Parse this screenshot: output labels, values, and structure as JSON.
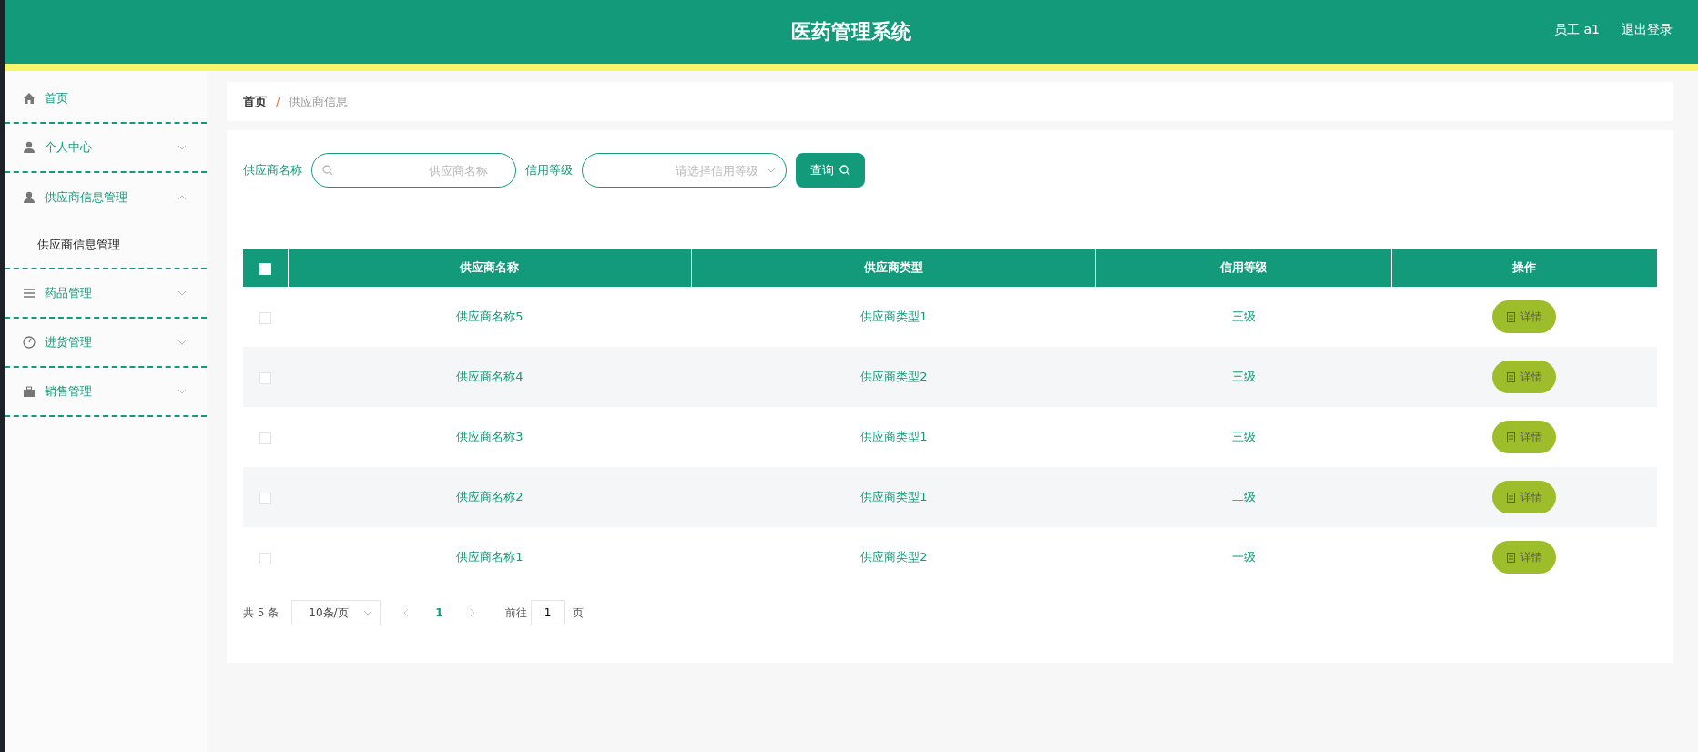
{
  "header": {
    "title": "医药管理系统",
    "user": "员工 a1",
    "logout": "退出登录"
  },
  "sidebar": {
    "items": [
      {
        "label": "首页"
      },
      {
        "label": "个人中心",
        "expanded": false
      },
      {
        "label": "供应商信息管理",
        "expanded": true,
        "children": [
          {
            "label": "供应商信息管理"
          }
        ]
      },
      {
        "label": "药品管理",
        "expanded": false
      },
      {
        "label": "进货管理",
        "expanded": false
      },
      {
        "label": "销售管理",
        "expanded": false
      }
    ]
  },
  "breadcrumb": {
    "separator": "/",
    "items": [
      "首页",
      "供应商信息"
    ]
  },
  "search": {
    "fields": [
      {
        "kind": "input",
        "label": "供应商名称",
        "placeholder": "供应商名称"
      },
      {
        "kind": "select",
        "label": "信用等级",
        "placeholder": "请选择信用等级"
      }
    ],
    "button": "查询"
  },
  "table": {
    "all_checked": false,
    "columns": [
      "供应商名称",
      "供应商类型",
      "信用等级",
      "操作"
    ],
    "rows": [
      {
        "checked": false,
        "cells": [
          "供应商名称5",
          "供应商类型1",
          "三级"
        ],
        "action": "详情"
      },
      {
        "checked": false,
        "cells": [
          "供应商名称4",
          "供应商类型2",
          "三级"
        ],
        "action": "详情"
      },
      {
        "checked": false,
        "cells": [
          "供应商名称3",
          "供应商类型1",
          "三级"
        ],
        "action": "详情"
      },
      {
        "checked": false,
        "cells": [
          "供应商名称2",
          "供应商类型1",
          "二级"
        ],
        "action": "详情"
      },
      {
        "checked": false,
        "cells": [
          "供应商名称1",
          "供应商类型2",
          "一级"
        ],
        "action": "详情"
      }
    ]
  },
  "pagination": {
    "total": "共 5 条",
    "page_size": "10条/页",
    "pages": [
      {
        "label": "1",
        "selected": true
      }
    ],
    "goto_label": "前往",
    "goto_value": "1",
    "page_unit": "页"
  }
}
